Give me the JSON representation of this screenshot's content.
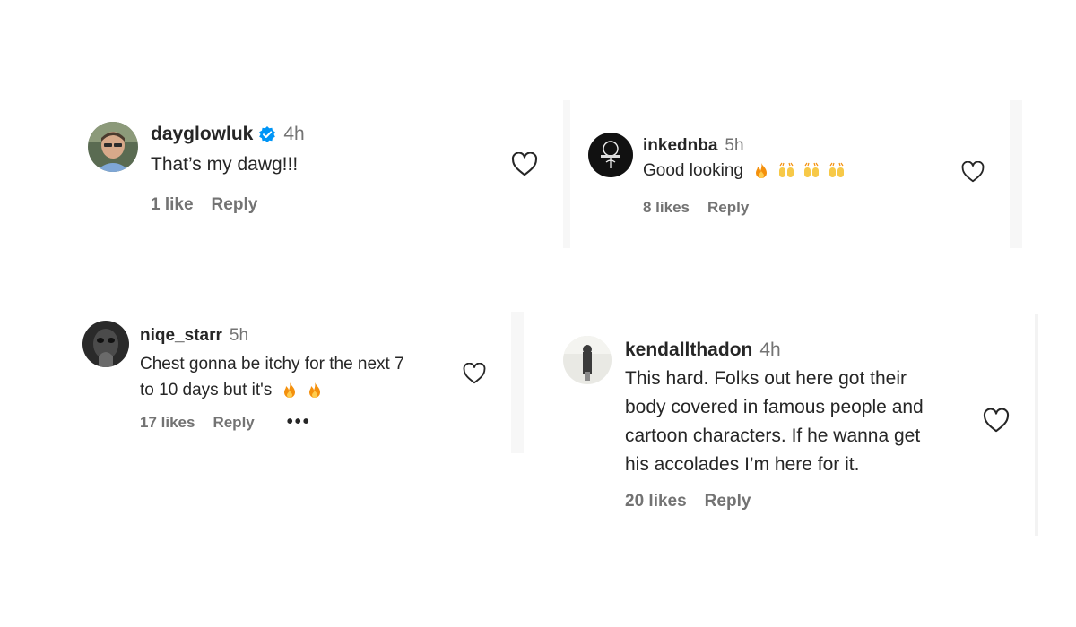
{
  "comments": [
    {
      "username": "dayglowluk",
      "verified": true,
      "time": "4h",
      "text": "That’s my dawg!!!",
      "likes": "1 like",
      "reply": "Reply"
    },
    {
      "username": "inkednba",
      "verified": false,
      "time": "5h",
      "text": "Good looking",
      "emojis": [
        "fire-emoji",
        "raising-hands-emoji",
        "raising-hands-emoji",
        "raising-hands-emoji"
      ],
      "likes": "8 likes",
      "reply": "Reply"
    },
    {
      "username": "niqe_starr",
      "verified": false,
      "time": "5h",
      "text_line1": "Chest gonna be itchy for the next 7",
      "text_line2": "to 10 days but it's",
      "emojis": [
        "fire-emoji",
        "fire-emoji"
      ],
      "likes": "17 likes",
      "reply": "Reply",
      "more": "•••"
    },
    {
      "username": "kendallthadon",
      "verified": false,
      "time": "4h",
      "text_lines": [
        "This hard. Folks out here got their",
        "body covered in famous people and",
        "cartoon characters. If he wanna get",
        "his accolades I’m here for it."
      ],
      "likes": "20 likes",
      "reply": "Reply"
    }
  ],
  "colors": {
    "verified": "#0095f6",
    "secondary_text": "#737373",
    "primary_text": "#262626",
    "fire": "#f4900c",
    "hands": "#f7c948"
  }
}
